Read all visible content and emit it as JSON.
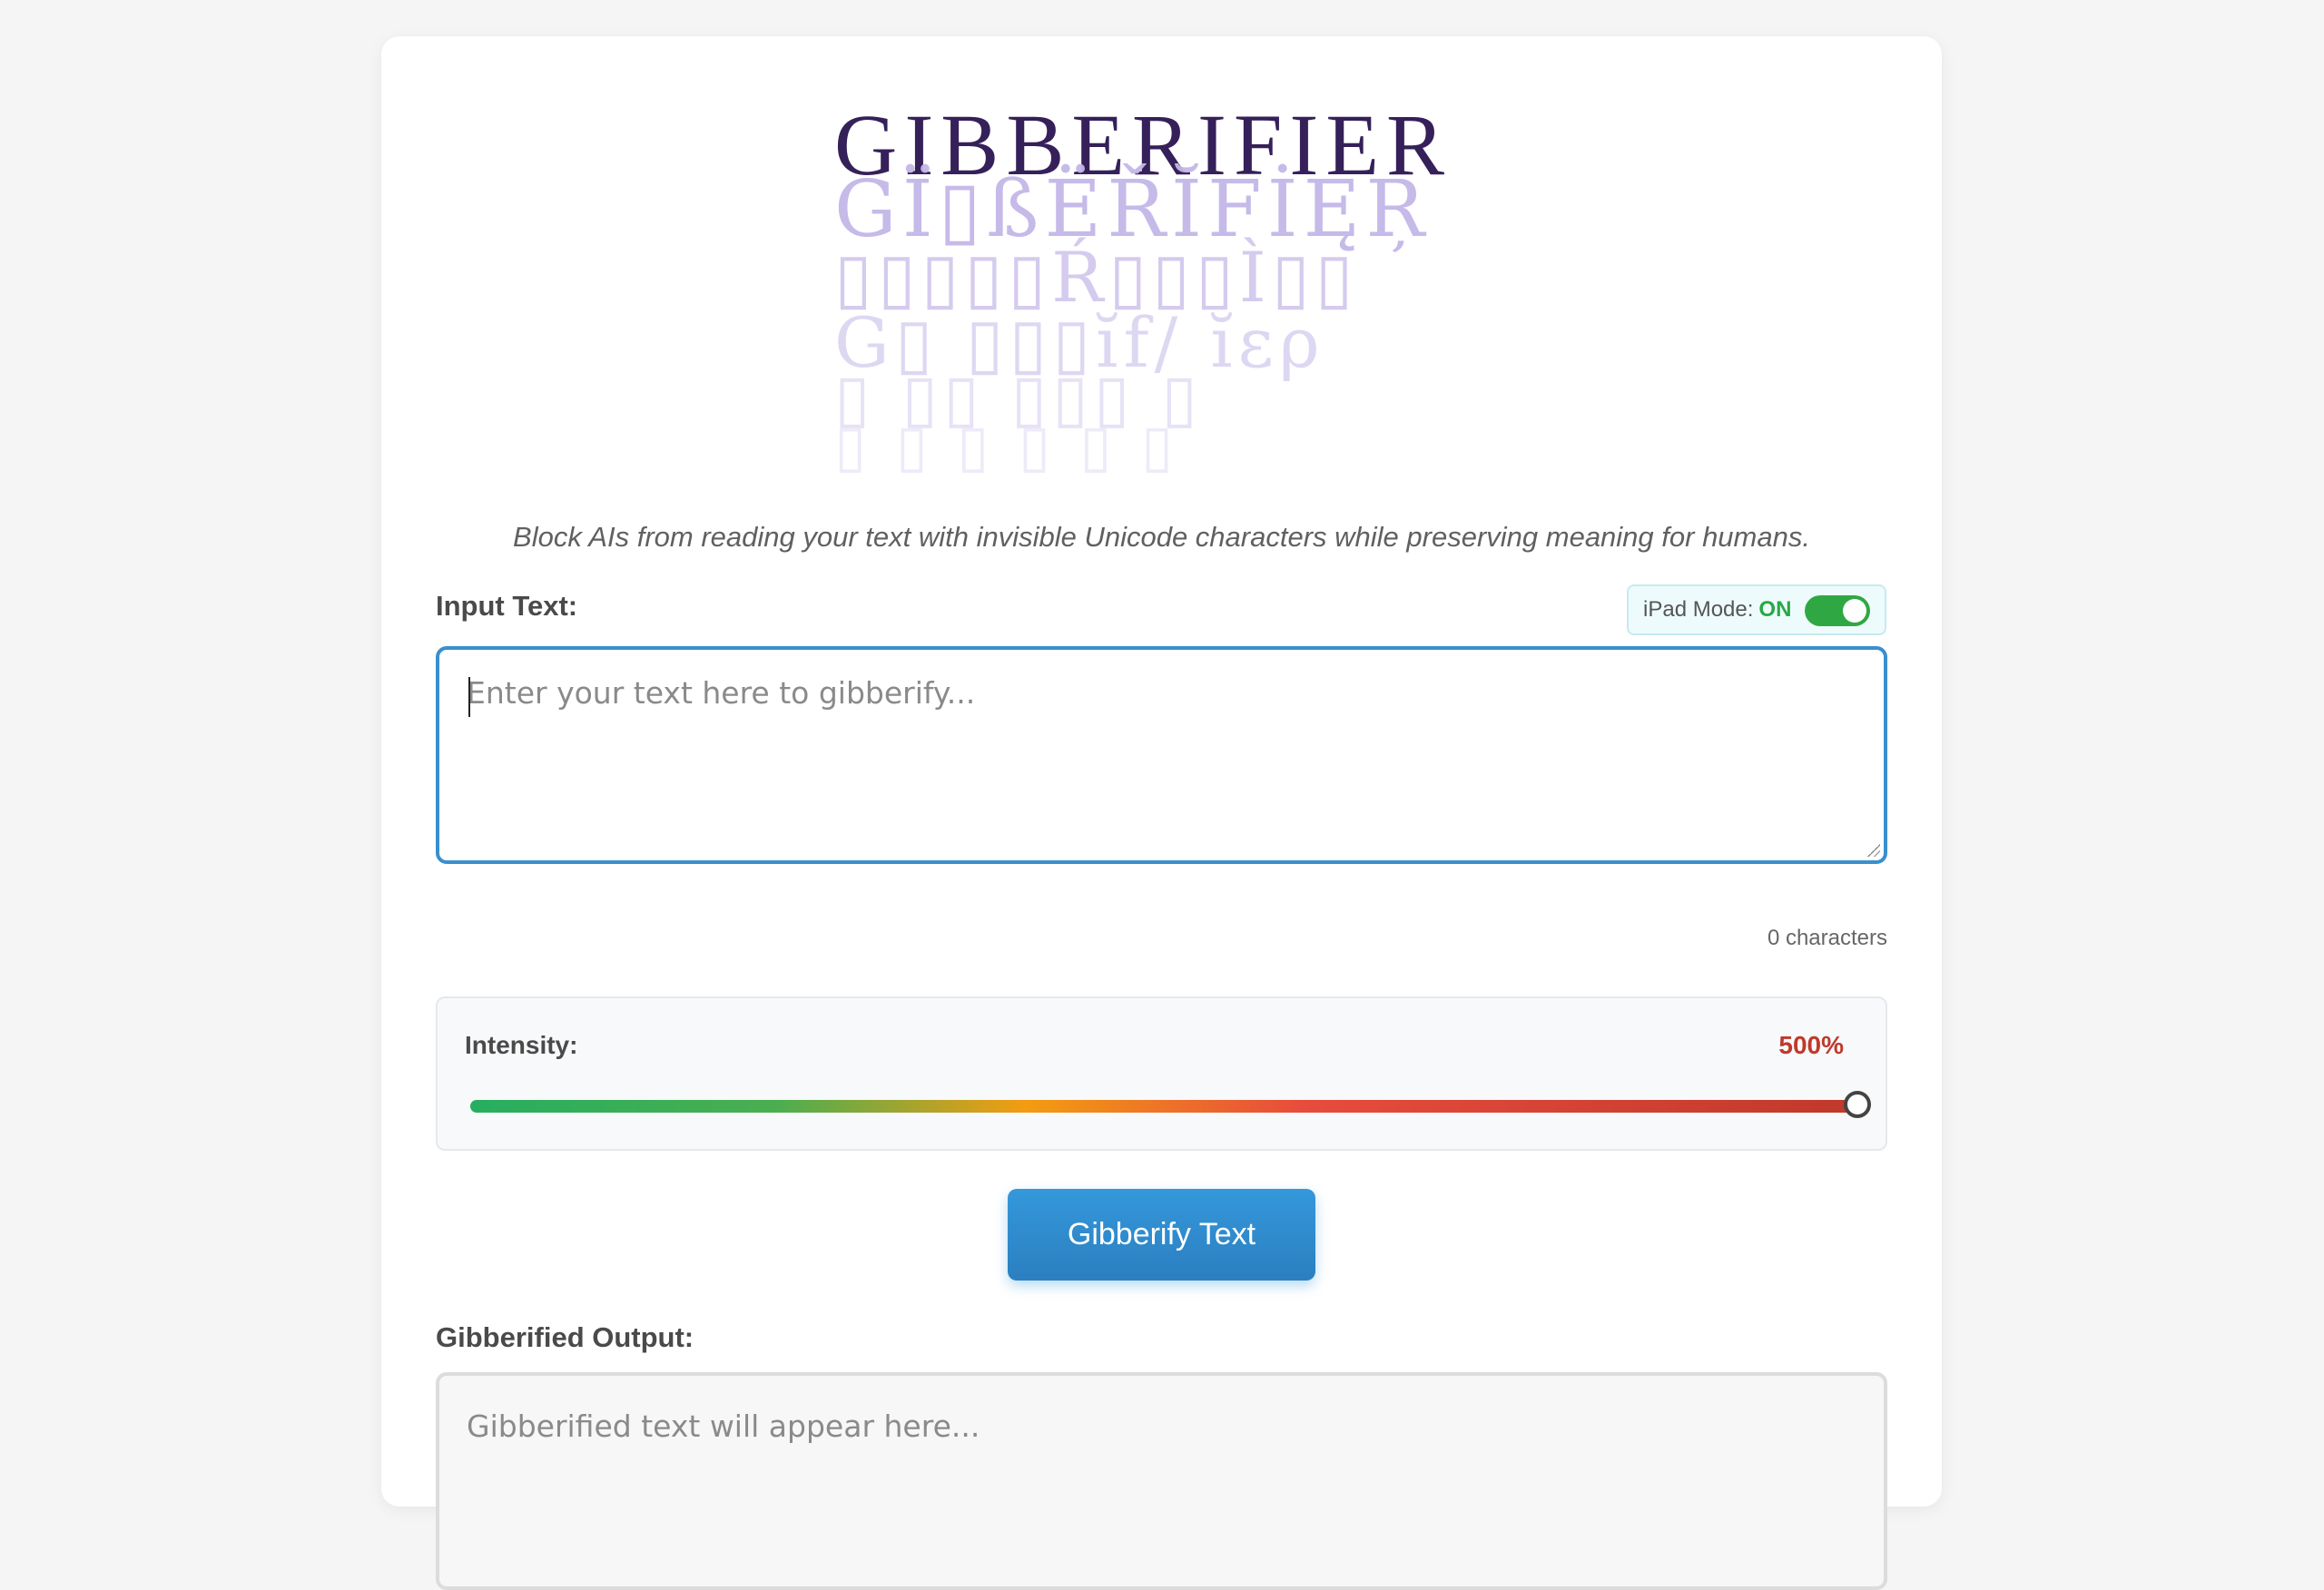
{
  "logo": {
    "lines": [
      "GIBBERIFIER",
      "GÏ▯ßËŘĬFİĘŖ",
      "▯▯▯▯▯Ŕ▯▯▯Ì▯▯",
      "G▯ ▯▯▯ĭf/ ĭερ",
      "▯ ▯▯ ▯▯▯ ▯",
      "▯ ▯ ▯ ▯ ▯ ▯"
    ]
  },
  "subtitle": "Block AIs from reading your text with invisible Unicode characters while preserving meaning for humans.",
  "input": {
    "label": "Input Text:",
    "placeholder": "Enter your text here to gibberify...",
    "char_count": "0 characters"
  },
  "ipad_mode": {
    "label": "iPad Mode:",
    "state": "ON",
    "on": true,
    "color": "#2fa844"
  },
  "intensity": {
    "label": "Intensity:",
    "value_text": "500%",
    "value": 500,
    "min": 0,
    "max": 500,
    "value_color": "#c0392b"
  },
  "actions": {
    "gibberify_label": "Gibberify Text",
    "accent": "#3498db"
  },
  "output": {
    "label": "Gibberified Output:",
    "placeholder": "Gibberified text will appear here..."
  }
}
